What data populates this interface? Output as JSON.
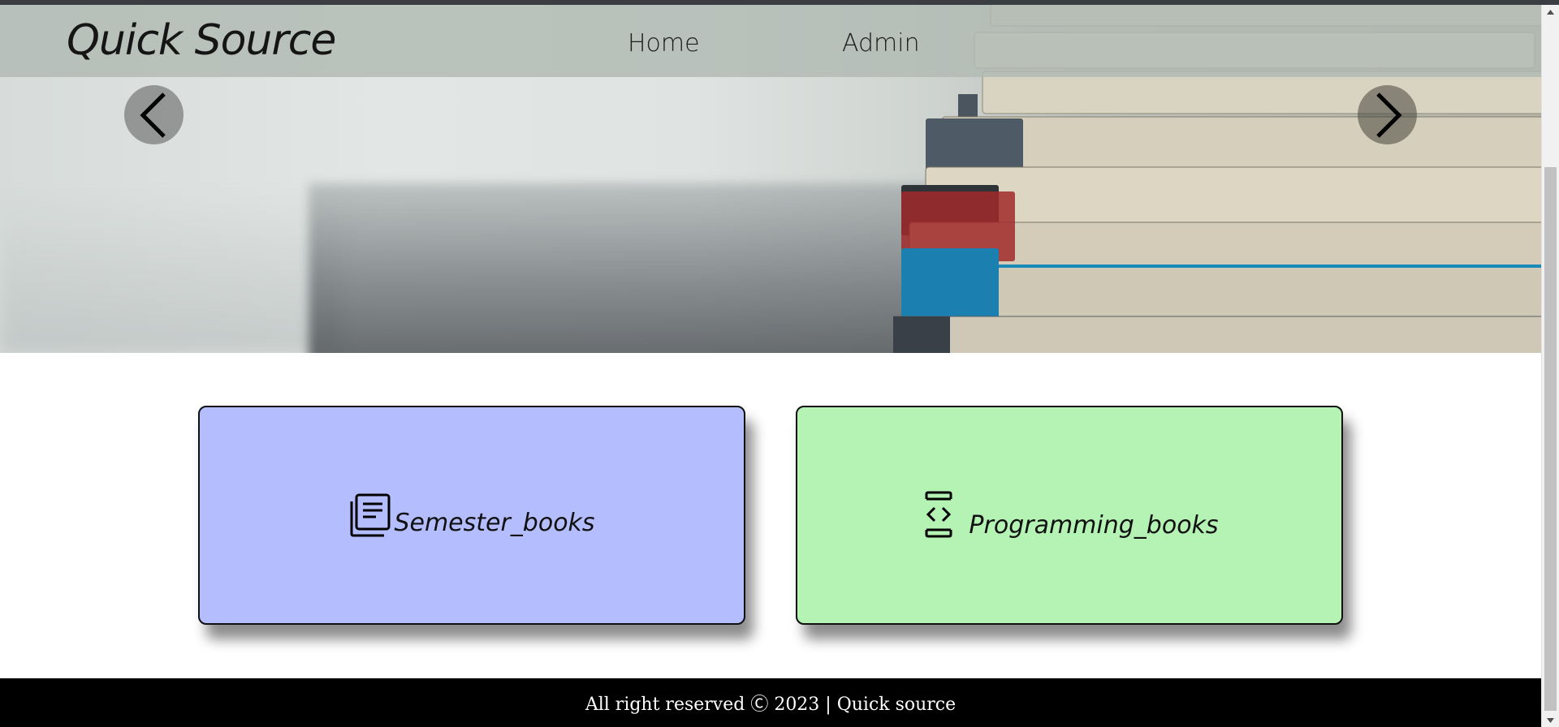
{
  "navbar": {
    "brand": "Quick Source",
    "links": [
      {
        "label": "Home"
      },
      {
        "label": "Admin"
      }
    ]
  },
  "carousel": {
    "prev_icon": "chevron-left-icon",
    "next_icon": "chevron-right-icon"
  },
  "cards": [
    {
      "label": "Semester_books",
      "icon": "newspaper-icon",
      "color": "#b4bdfe"
    },
    {
      "label": "Programming_books",
      "icon": "code-icon",
      "color": "#b4f3b4"
    }
  ],
  "footer": {
    "text": "All right reserved Ⓒ 2023 | Quick source",
    "background": "#000000"
  }
}
